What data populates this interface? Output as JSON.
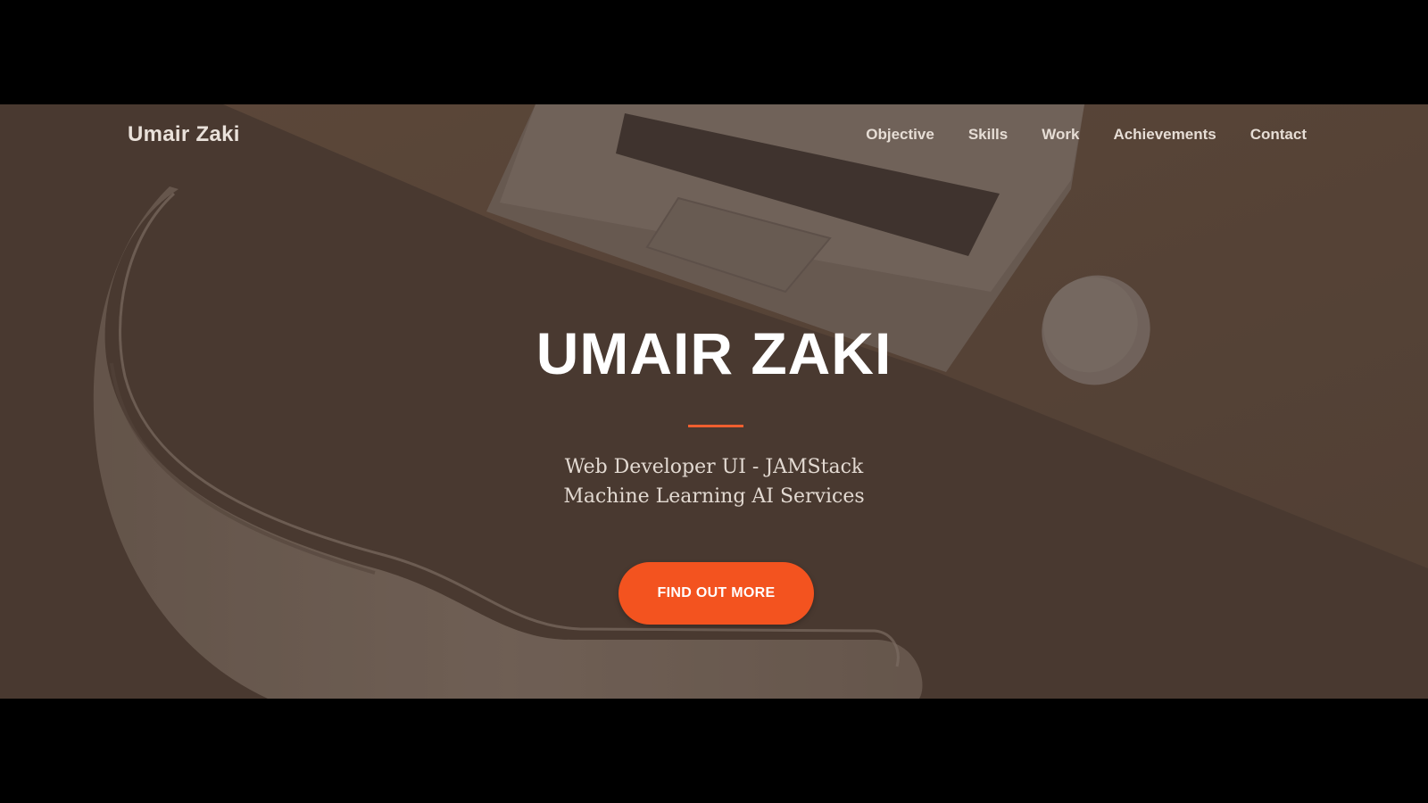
{
  "brand": "Umair Zaki",
  "nav": {
    "items": [
      "Objective",
      "Skills",
      "Work",
      "Achievements",
      "Contact"
    ]
  },
  "hero": {
    "title": "UMAIR ZAKI",
    "subtitle_lines": [
      "Web Developer UI - JAMStack",
      "Machine Learning AI Services"
    ],
    "cta_label": "FIND OUT MORE"
  },
  "colors": {
    "accent": "#f3531f",
    "overlay": "#4f4037",
    "letterbox": "#000000"
  },
  "icons": [
    "laptop-illustration",
    "mouse-illustration",
    "chair-illustration"
  ]
}
